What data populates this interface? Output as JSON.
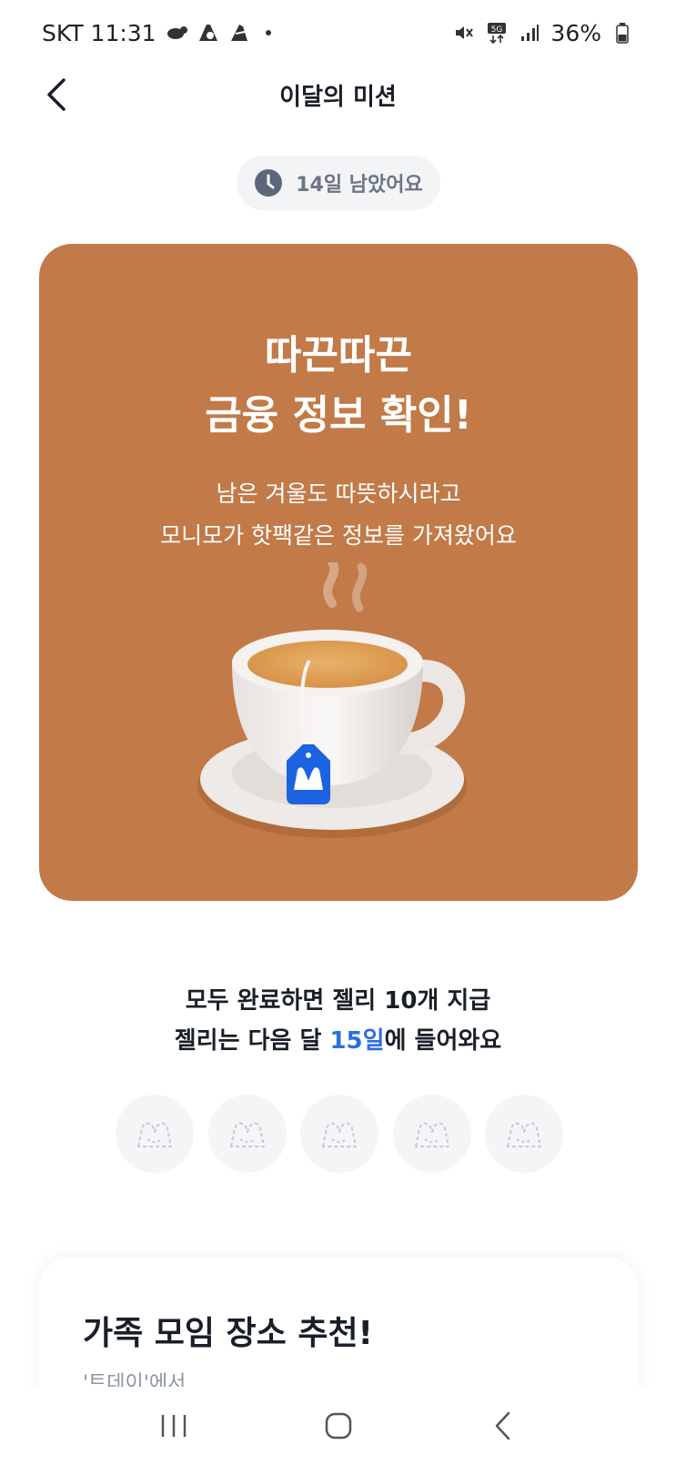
{
  "status_bar": {
    "carrier_time": "SKT 11:31",
    "battery": "36%"
  },
  "header": {
    "title": "이달의 미션"
  },
  "deadline": {
    "text": "14일 남았어요"
  },
  "mission_card": {
    "title_line1": "따끈따끈",
    "title_line2": "금융 정보 확인!",
    "desc_line1": "남은 겨울도 따뜻하시라고",
    "desc_line2": "모니모가 핫팩같은 정보를 가져왔어요",
    "background_color": "#c17a48"
  },
  "reward": {
    "line1": "모두 완료하면 젤리 10개 지급",
    "line2_pre": "젤리는 다음 달 ",
    "line2_highlight": "15일",
    "line2_post": "에 들어와요",
    "highlight_color": "#2b6fe0"
  },
  "jelly_slots": [
    "jelly-empty",
    "jelly-empty",
    "jelly-empty",
    "jelly-empty",
    "jelly-empty"
  ],
  "next_mission": {
    "title": "가족 모임 장소 추천!",
    "subtitle": "'트데이'에서"
  }
}
